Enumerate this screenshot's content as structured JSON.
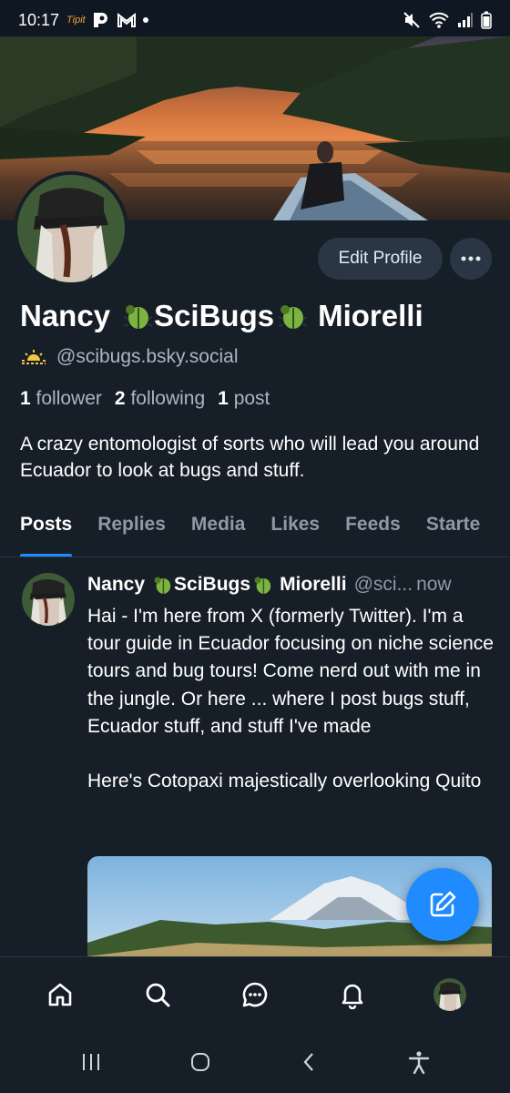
{
  "status_bar": {
    "time": "10:17",
    "tiny_label": "Tipit",
    "icons": [
      "p-app-icon",
      "gmail-icon",
      "dot-icon",
      "mute-icon",
      "wifi-icon",
      "signal-icon",
      "battery-icon"
    ]
  },
  "profile": {
    "name_part1": "Nancy",
    "name_part2": "SciBugs",
    "name_part3": "Miorelli",
    "handle": "@scibugs.bsky.social",
    "followers_count": "1",
    "followers_label": "follower",
    "following_count": "2",
    "following_label": "following",
    "posts_count": "1",
    "posts_label": "post",
    "bio": "A crazy entomologist of sorts who will lead you around Ecuador to look at bugs and stuff.",
    "edit_label": "Edit Profile"
  },
  "tabs": [
    {
      "label": "Posts",
      "active": true
    },
    {
      "label": "Replies"
    },
    {
      "label": "Media"
    },
    {
      "label": "Likes"
    },
    {
      "label": "Feeds"
    },
    {
      "label": "Starte"
    }
  ],
  "post": {
    "name_part1": "Nancy",
    "name_part2": "SciBugs",
    "name_part3": "Miorelli",
    "handle": "@sci...",
    "time": "now",
    "text": "Hai - I'm here from X (formerly Twitter). I'm a tour guide in Ecuador focusing on niche science tours and bug tours! Come nerd out with me in the jungle. Or here ... where I post bugs stuff, Ecuador stuff, and  stuff I've made\n\nHere's Cotopaxi majestically overlooking Quito"
  },
  "colors": {
    "background": "#161e27",
    "accent": "#208bfe",
    "muted_text": "#8d9aa8",
    "button_bg": "#2a3644"
  }
}
